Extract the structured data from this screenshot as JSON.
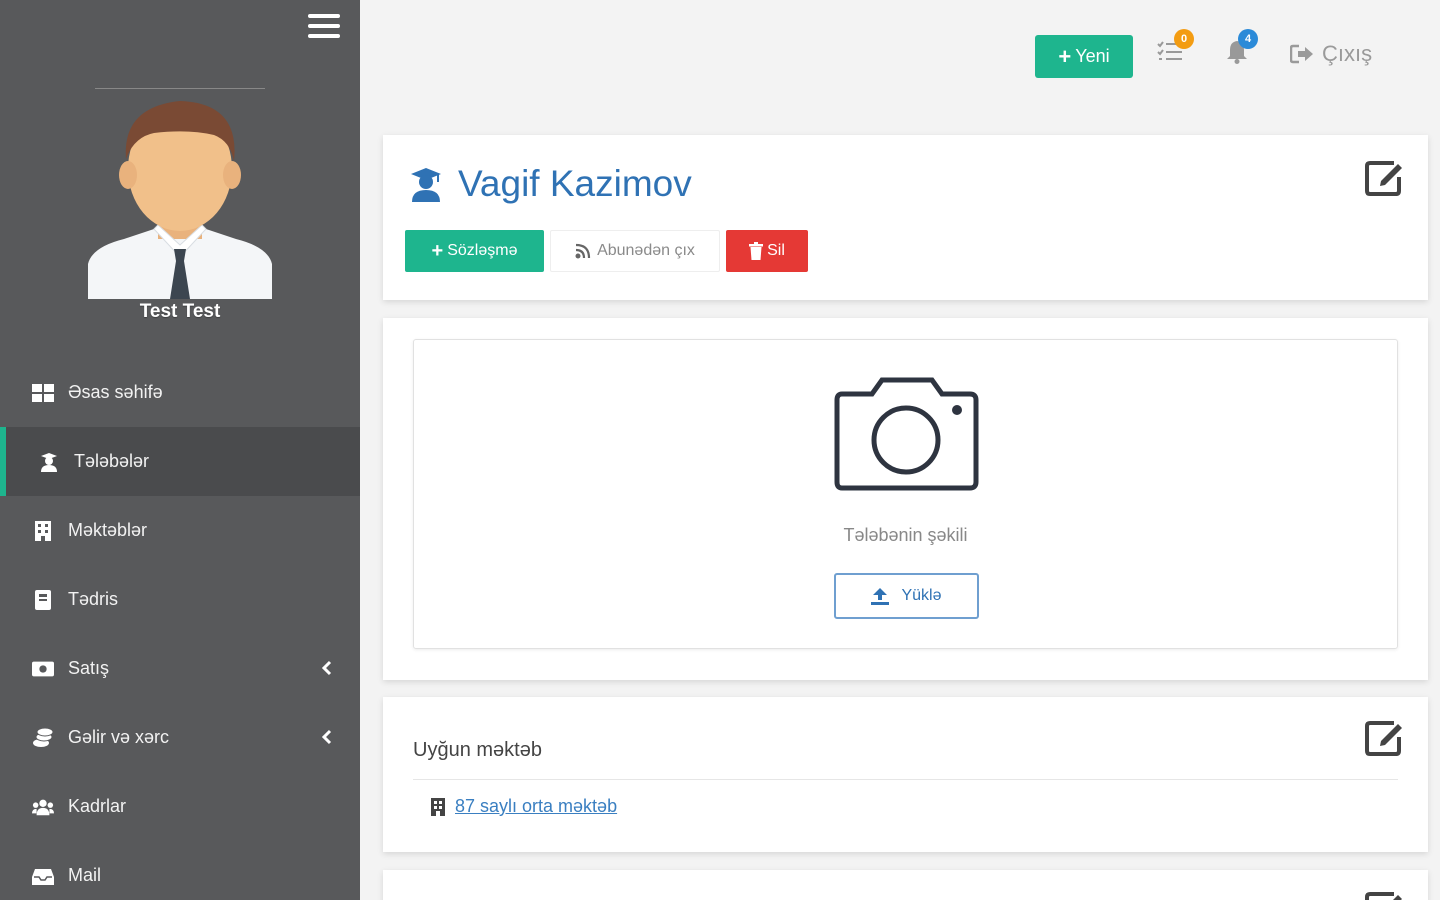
{
  "sidebar": {
    "user_name": "Test Test",
    "items": [
      {
        "label": "Əsas səhifə",
        "icon": "dashboard-icon"
      },
      {
        "label": "Tələbələr",
        "icon": "student-icon",
        "active": true
      },
      {
        "label": "Məktəblər",
        "icon": "building-icon"
      },
      {
        "label": "Tədris",
        "icon": "book-icon"
      },
      {
        "label": "Satış",
        "icon": "money-icon",
        "has_submenu": true
      },
      {
        "label": "Gəlir və xərc",
        "icon": "coins-icon",
        "has_submenu": true
      },
      {
        "label": "Kadrlar",
        "icon": "users-icon"
      },
      {
        "label": "Mail",
        "icon": "inbox-icon"
      }
    ]
  },
  "topbar": {
    "new_label": "Yeni",
    "tasks_badge": "0",
    "notifications_badge": "4",
    "logout_label": "Çıxış"
  },
  "student": {
    "name": "Vagif Kazimov",
    "contract_label": "Sözləşmə",
    "unsubscribe_label": "Abunədən çıx",
    "delete_label": "Sil"
  },
  "photo": {
    "caption": "Tələbənin şəkili",
    "upload_label": "Yüklə"
  },
  "school": {
    "heading": "Uyğun məktəb",
    "link_label": "87 saylı orta məktəb"
  },
  "colors": {
    "sidebar": "#58595b",
    "accent_green": "#1eb58e",
    "danger": "#e53935",
    "primary_blue": "#2f72b4",
    "badge_orange": "#f39c12",
    "badge_blue": "#2b8ad8"
  }
}
